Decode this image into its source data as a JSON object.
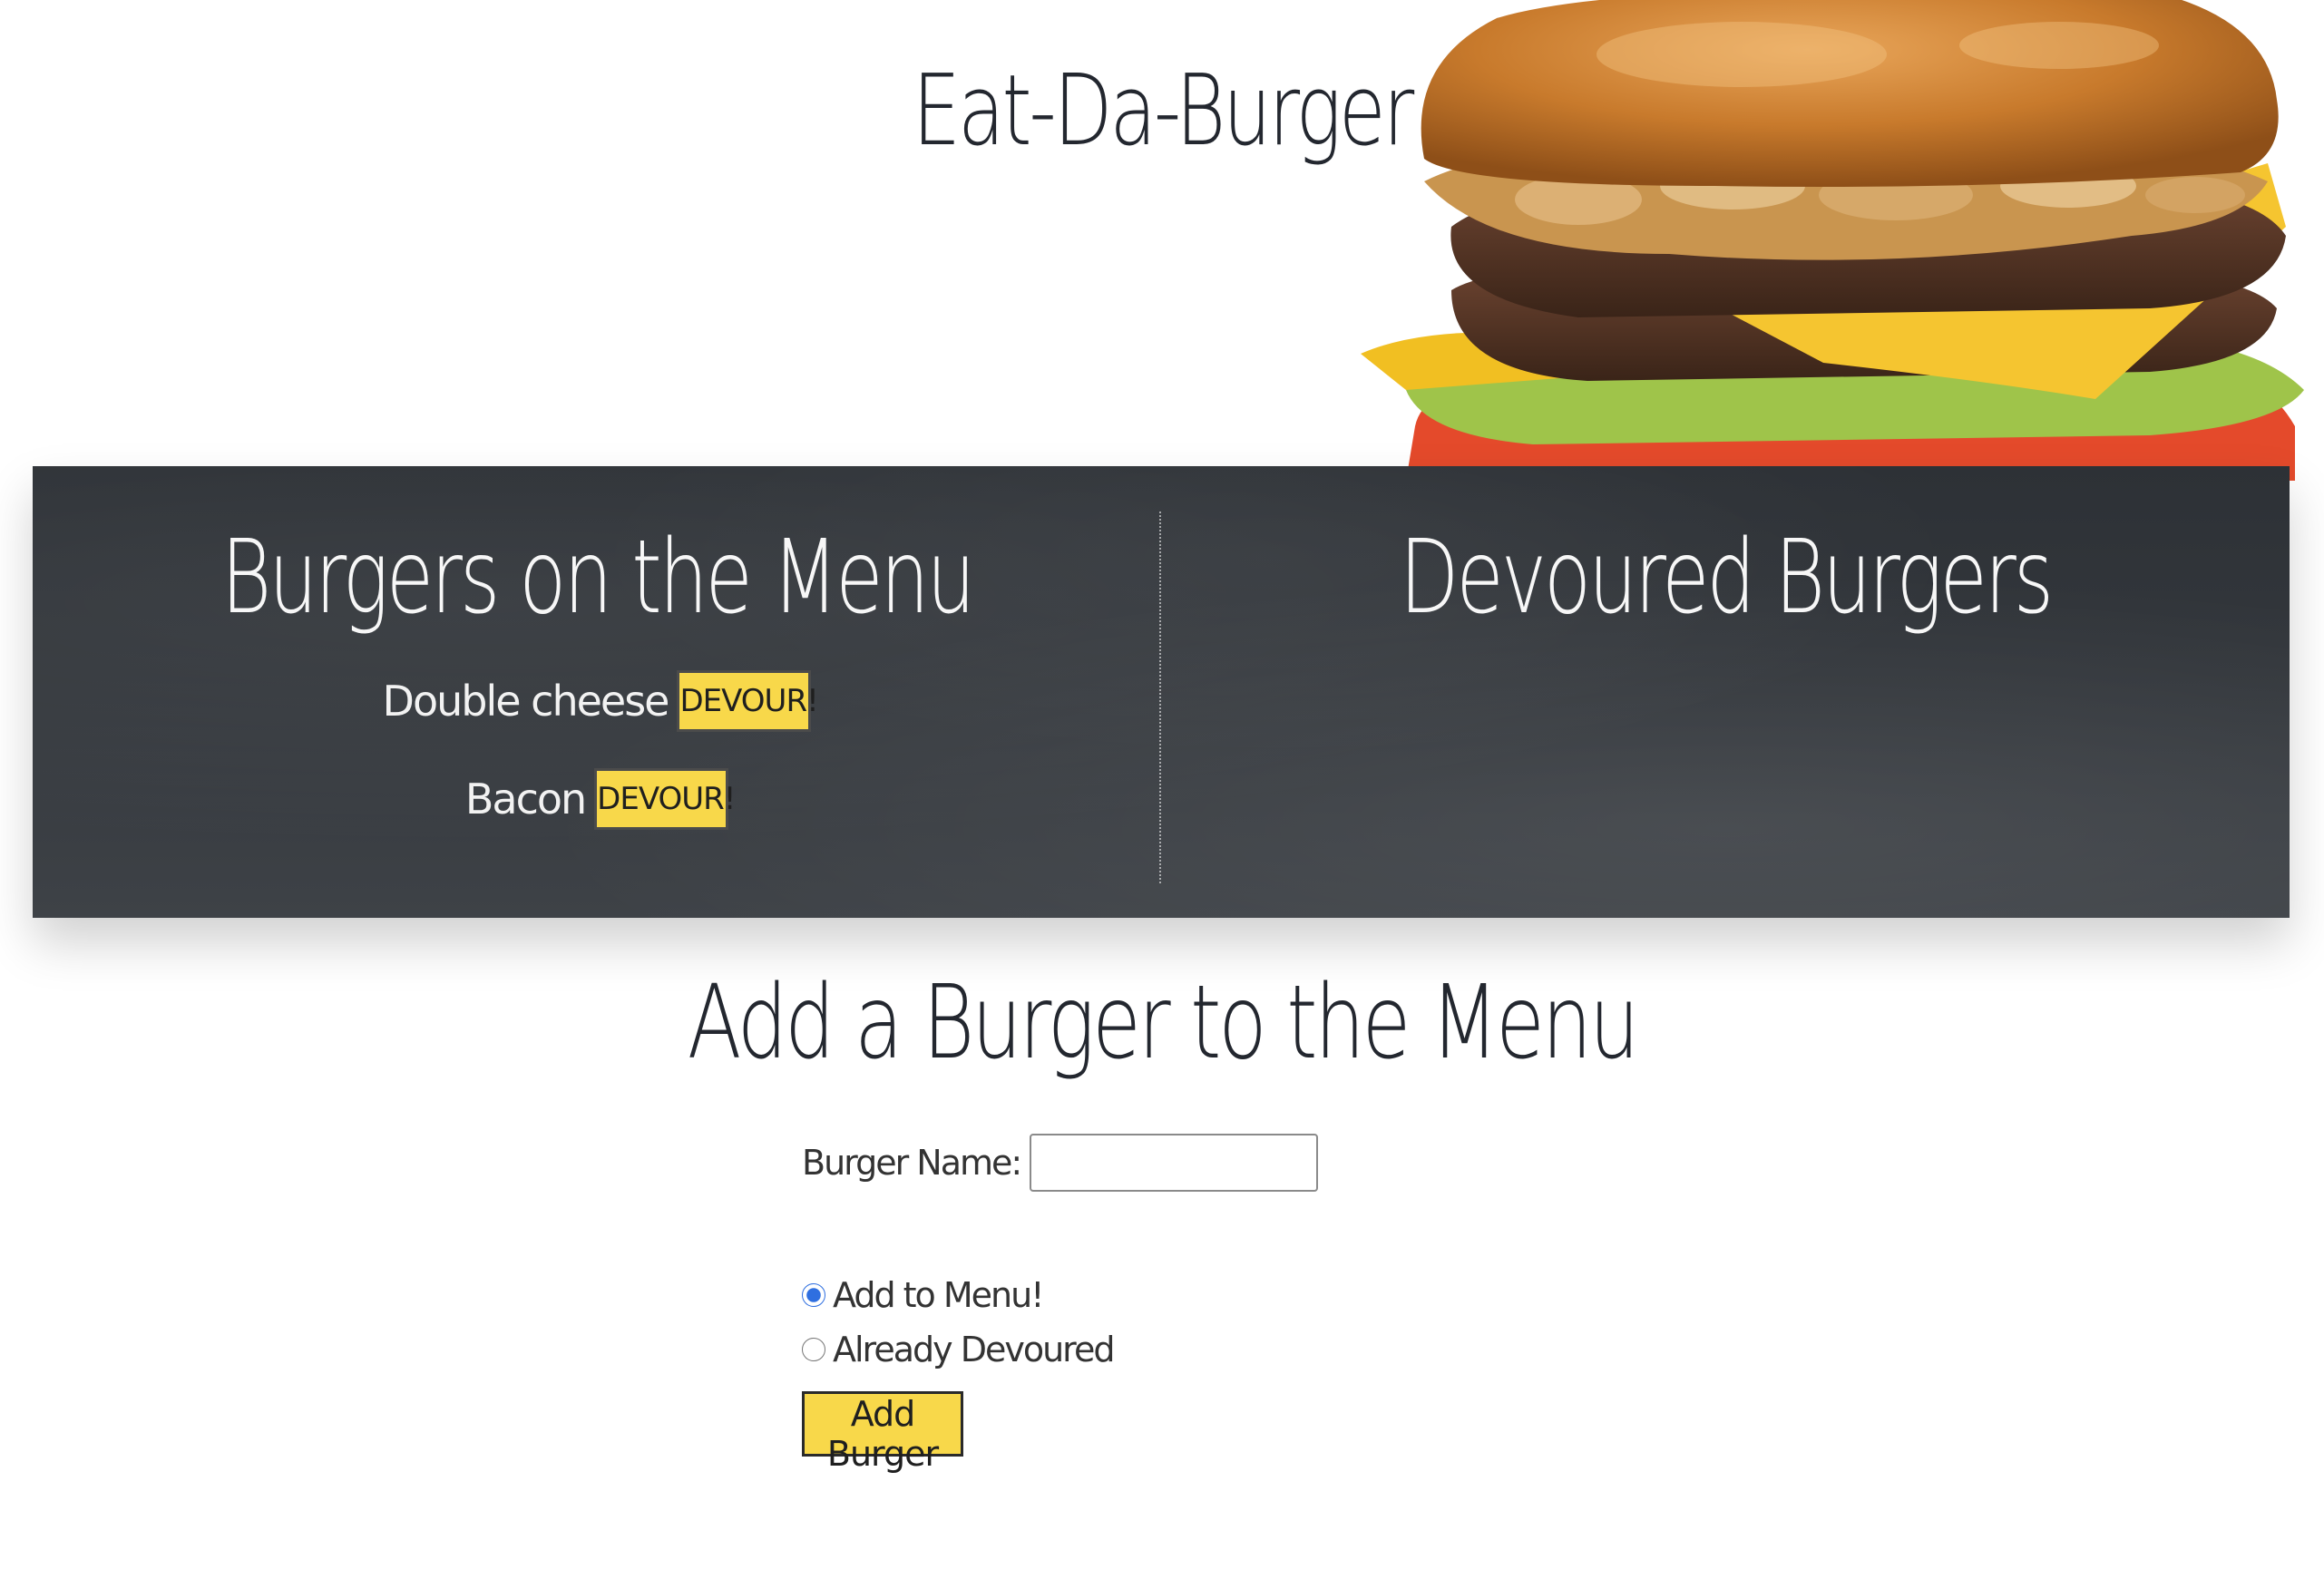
{
  "header": {
    "title": "Eat-Da-Burger"
  },
  "menu": {
    "heading": "Burgers on the Menu",
    "items": [
      {
        "name": "Double cheese",
        "button_label": "DEVOUR!"
      },
      {
        "name": "Bacon",
        "button_label": "DEVOUR!"
      }
    ]
  },
  "devoured": {
    "heading": "Devoured Burgers",
    "items": []
  },
  "form": {
    "heading": "Add a Burger to the Menu",
    "name_label": "Burger Name:",
    "name_value": "",
    "options": [
      {
        "label": "Add to Menu!",
        "checked": true
      },
      {
        "label": "Already Devoured",
        "checked": false
      }
    ],
    "submit_label": "Add Burger"
  },
  "colors": {
    "button_yellow": "#f8d84a",
    "chalkboard": "#33373c",
    "text_dark": "#23272f"
  },
  "icons": {
    "hero_image": "burger-illustration"
  }
}
